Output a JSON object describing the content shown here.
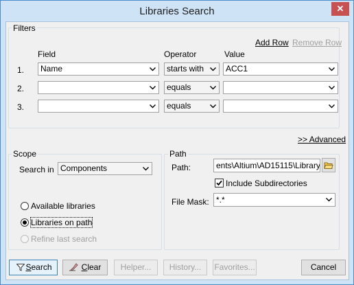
{
  "window": {
    "title": "Libraries Search",
    "close_glyph": "✕"
  },
  "filters": {
    "label": "Filters",
    "add_row": "Add Row",
    "remove_row": "Remove Row",
    "headers": {
      "field": "Field",
      "operator": "Operator",
      "value": "Value"
    },
    "rows": [
      {
        "num": "1.",
        "field": "Name",
        "operator": "starts with",
        "value": "ACC1"
      },
      {
        "num": "2.",
        "field": "",
        "operator": "equals",
        "value": ""
      },
      {
        "num": "3.",
        "field": "",
        "operator": "equals",
        "value": ""
      }
    ]
  },
  "advanced_link": ">> Advanced",
  "scope": {
    "label": "Scope",
    "search_in_label": "Search in",
    "search_in_value": "Components",
    "options": [
      {
        "label": "Available libraries",
        "checked": false,
        "disabled": false
      },
      {
        "label": "Libraries on path",
        "checked": true,
        "disabled": false
      },
      {
        "label": "Refine last search",
        "checked": false,
        "disabled": true
      }
    ]
  },
  "path": {
    "label": "Path",
    "path_label": "Path:",
    "path_value": "ents\\Altium\\AD15115\\Library\\",
    "include_subdirs": "Include Subdirectories",
    "include_subdirs_checked": true,
    "file_mask_label": "File Mask:",
    "file_mask_value": "*.*"
  },
  "buttons": {
    "search": "Search",
    "clear": "Clear",
    "helper": "Helper...",
    "history": "History...",
    "favorites": "Favorites...",
    "cancel": "Cancel"
  }
}
